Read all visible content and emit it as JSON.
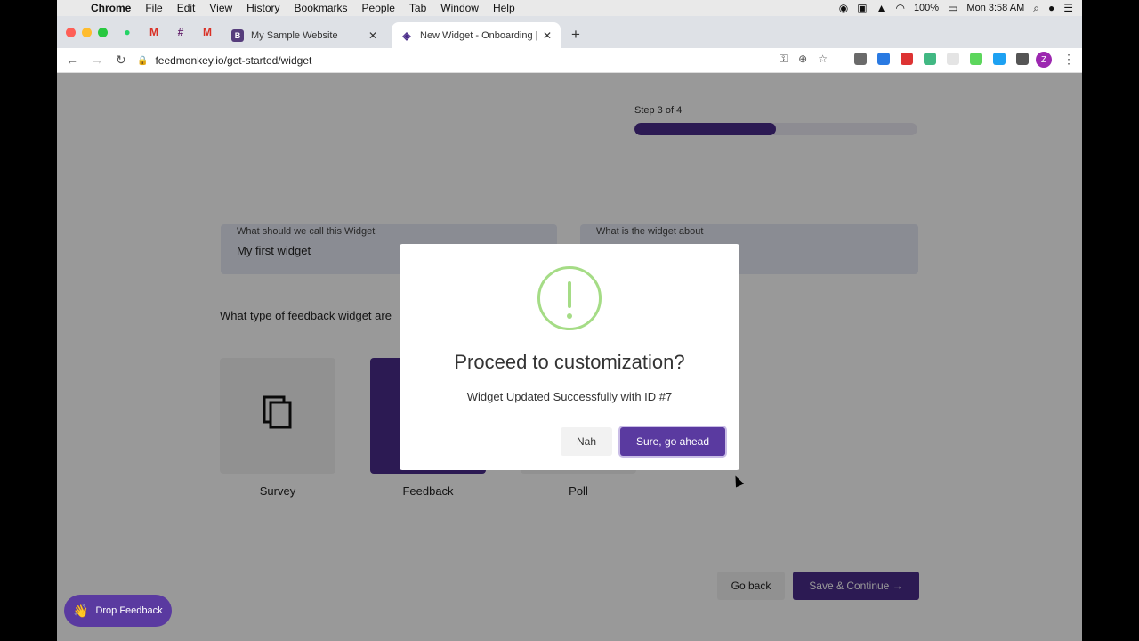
{
  "menubar": {
    "app": "Chrome",
    "items": [
      "File",
      "Edit",
      "View",
      "History",
      "Bookmarks",
      "People",
      "Tab",
      "Window",
      "Help"
    ],
    "battery": "100%",
    "clock": "Mon 3:58 AM"
  },
  "browser": {
    "tabs": [
      {
        "title": "My Sample Website",
        "favicon": "B"
      },
      {
        "title": "New Widget - Onboarding | Fe"
      }
    ],
    "url": "feedmonkey.io/get-started/widget",
    "profile_initial": "Z"
  },
  "page": {
    "step": "Step 3 of 4",
    "progress": 0.5,
    "fields": [
      {
        "label": "What should we call this Widget",
        "value": "My first widget"
      },
      {
        "label": "What is the widget about",
        "value": ""
      }
    ],
    "question": "What type of feedback widget are",
    "types": [
      "Survey",
      "Feedback",
      "Poll"
    ],
    "go_back": "Go back",
    "save_continue": "Save & Continue →",
    "drop_feedback": "Drop Feedback"
  },
  "modal": {
    "title": "Proceed to customization?",
    "message": "Widget Updated Successfully with ID #7",
    "cancel": "Nah",
    "confirm": "Sure, go ahead"
  },
  "colors": {
    "accent": "#4a2c8a",
    "success": "#a5dc86"
  }
}
